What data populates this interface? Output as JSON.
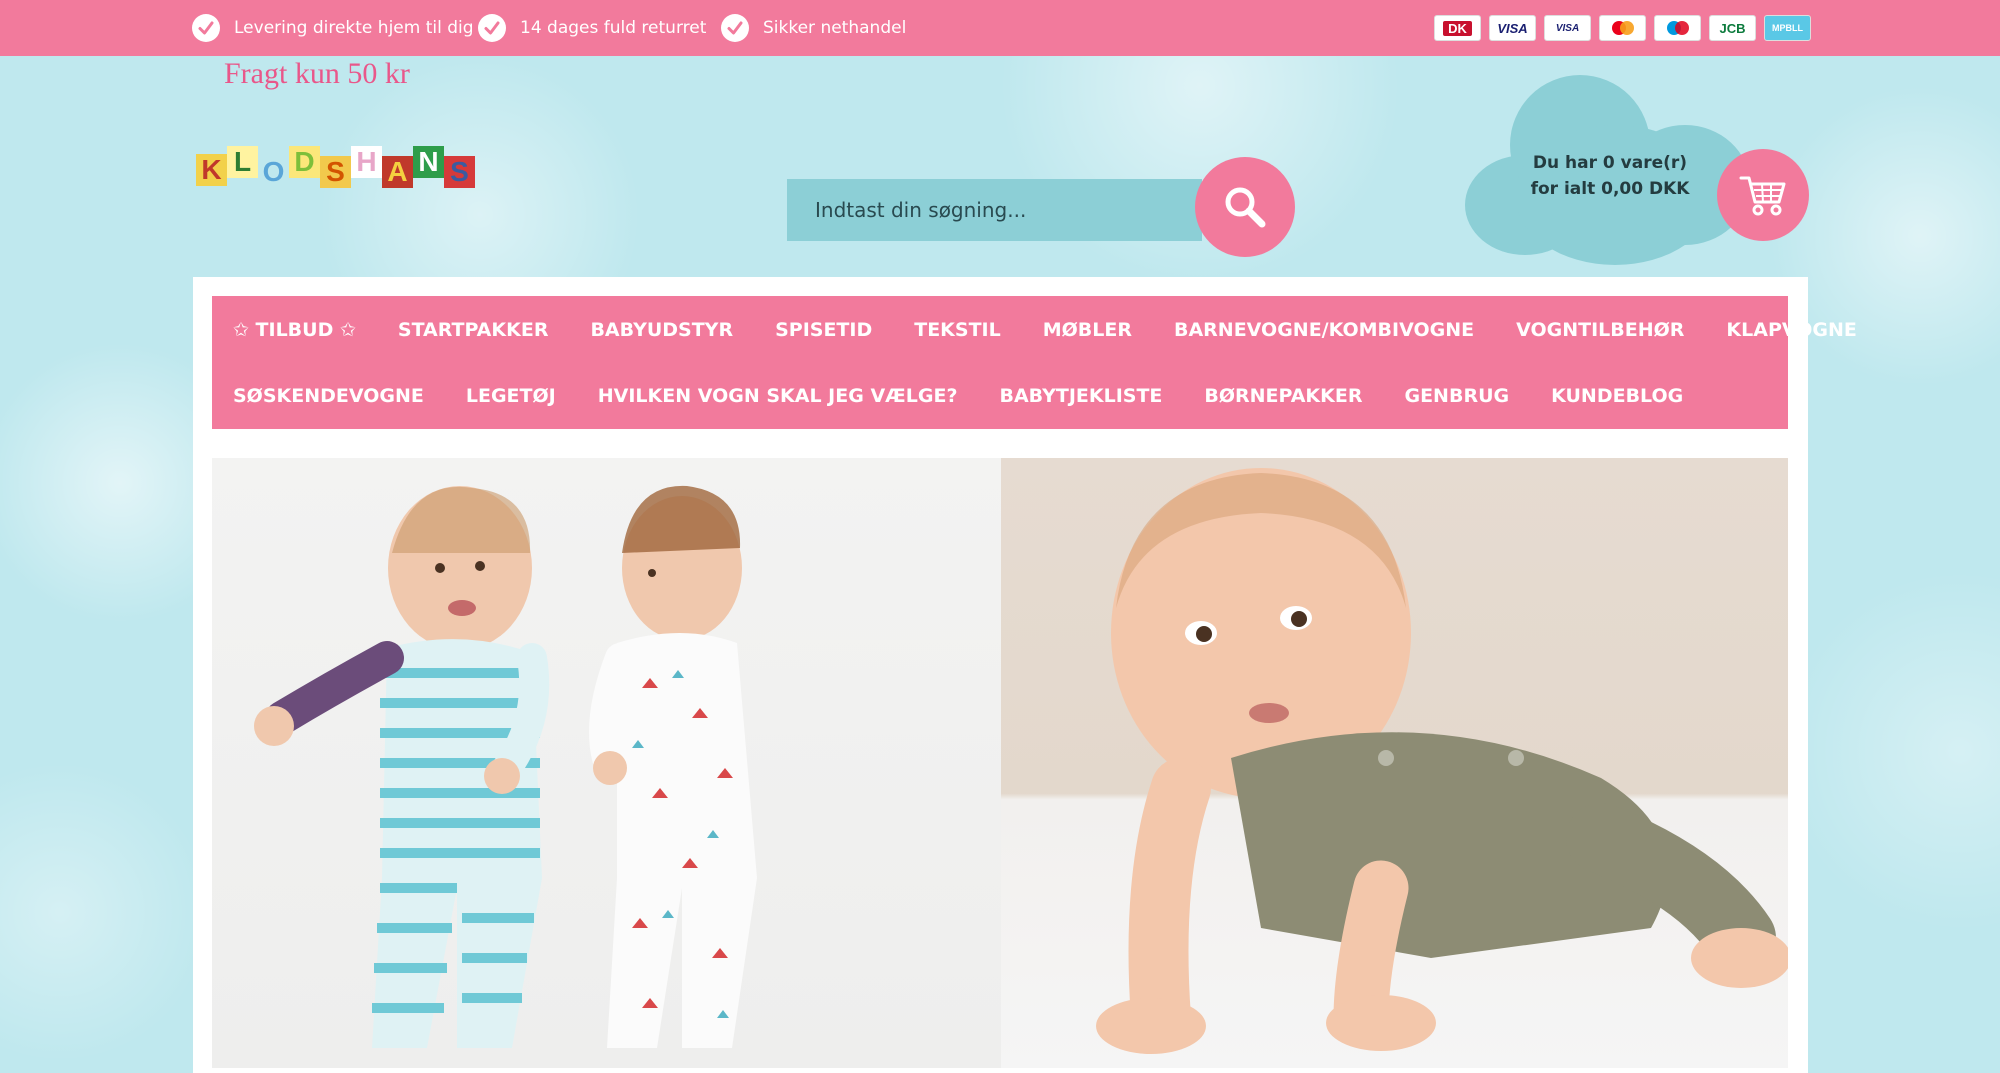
{
  "topbar": {
    "usps": [
      {
        "text": "Levering direkte hjem til dig"
      },
      {
        "text": "14 dages fuld returret"
      },
      {
        "text": "Sikker nethandel"
      }
    ],
    "payment_cards": [
      {
        "label": "DK",
        "icon": "dankort-icon"
      },
      {
        "label": "VISA",
        "icon": "visa-icon"
      },
      {
        "label": "VISA",
        "icon": "visa-electron-icon"
      },
      {
        "label": "",
        "icon": "mastercard-icon"
      },
      {
        "label": "",
        "icon": "maestro-icon"
      },
      {
        "label": "JCB",
        "icon": "jcb-icon"
      },
      {
        "label": "MPBLL",
        "icon": "mobilepay-icon"
      }
    ]
  },
  "promo": {
    "text": "Fragt kun 50 kr"
  },
  "logo": {
    "letters": [
      "K",
      "L",
      "O",
      "D",
      "S",
      "H",
      "A",
      "N",
      "S"
    ]
  },
  "search": {
    "placeholder": "Indtast din søgning..."
  },
  "cart": {
    "line1": "Du har 0 vare(r)",
    "line2": "for ialt 0,00 DKK"
  },
  "nav": {
    "row1": [
      "✩ TILBUD ✩",
      "STARTPAKKER",
      "BABYUDSTYR",
      "SPISETID",
      "TEKSTIL",
      "MØBLER",
      "BARNEVOGNE/KOMBIVOGNE",
      "VOGNTILBEHØR",
      "KLAPVOGNE"
    ],
    "row2": [
      "SØSKENDEVOGNE",
      "LEGETØJ",
      "HVILKEN VOGN SKAL JEG VÆLGE?",
      "BABYTJEKLISTE",
      "BØRNEPAKKER",
      "GENBRUG",
      "KUNDEBLOG"
    ]
  },
  "colors": {
    "brand_pink": "#f27a9c",
    "teal": "#8ccfd6",
    "background": "#bfe8ee"
  }
}
